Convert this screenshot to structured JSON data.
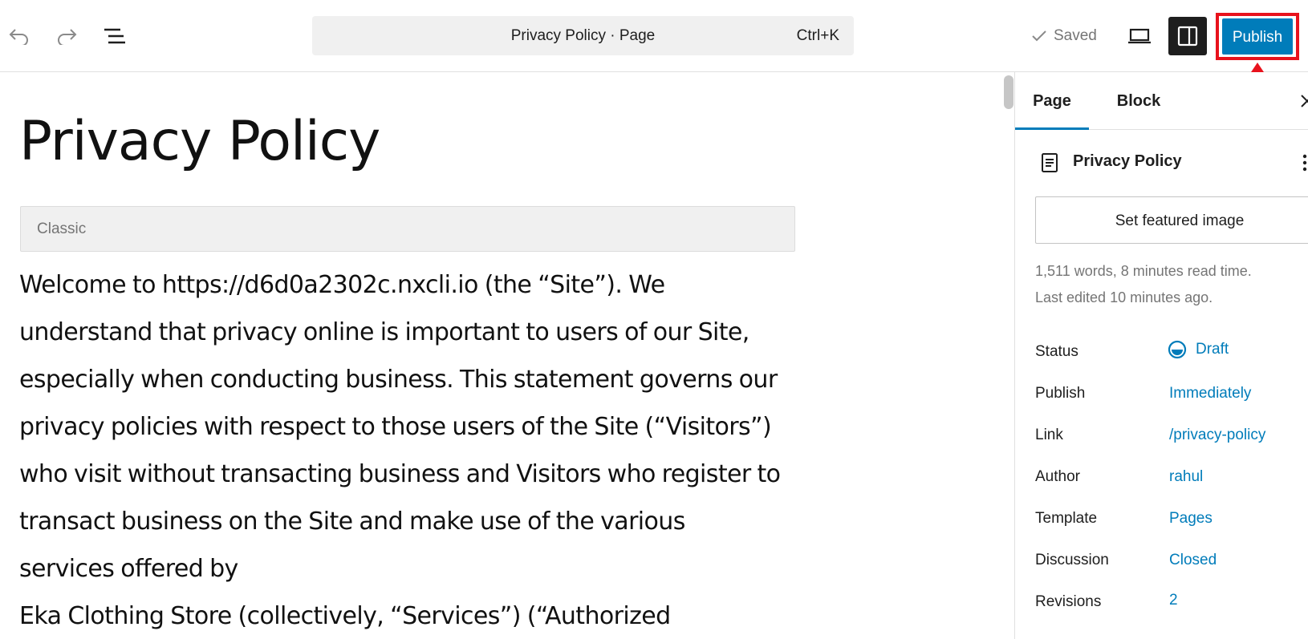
{
  "toolbar": {
    "command_title": "Privacy Policy · Page",
    "command_shortcut": "Ctrl+K",
    "saved_label": "Saved",
    "publish_label": "Publish",
    "accent_color": "#007cba",
    "highlight_color": "#e8121c"
  },
  "editor": {
    "page_title": "Privacy Policy",
    "classic_block_label": "Classic",
    "body_lines": [
      "Welcome to https://d6d0a2302c.nxcli.io (the “Site”). We",
      "understand that privacy online is important to users of our Site,",
      "especially when conducting business. This statement governs our",
      "privacy policies with respect to those users of the Site (“Visitors”)",
      "who visit without transacting business and Visitors who register to",
      "transact business on the Site and make use of the various",
      "services offered by",
      "Eka Clothing Store (collectively, “Services”) (“Authorized"
    ]
  },
  "sidebar": {
    "tabs": [
      {
        "label": "Page",
        "active": true
      },
      {
        "label": "Block",
        "active": false
      }
    ],
    "doc_title": "Privacy Policy",
    "featured_image_label": "Set featured image",
    "meta_words": "1,511 words, 8 minutes read time.",
    "meta_edited": "Last edited 10 minutes ago.",
    "rows": [
      {
        "label": "Status",
        "value": "Draft"
      },
      {
        "label": "Publish",
        "value": "Immediately"
      },
      {
        "label": "Link",
        "value": "/privacy-policy"
      },
      {
        "label": "Author",
        "value": "rahul"
      },
      {
        "label": "Template",
        "value": "Pages"
      },
      {
        "label": "Discussion",
        "value": "Closed"
      },
      {
        "label": "Revisions",
        "value": "2"
      }
    ]
  }
}
